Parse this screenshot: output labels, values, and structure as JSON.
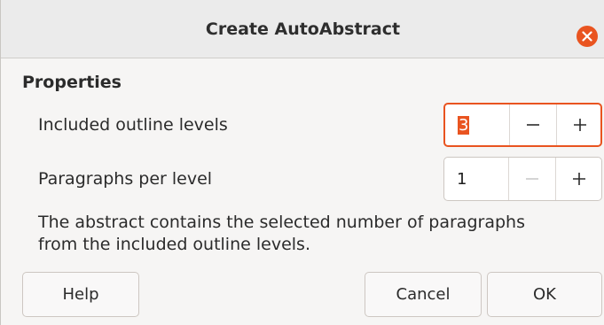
{
  "window": {
    "title": "Create AutoAbstract",
    "close_icon": "close-icon",
    "accent": "#e95420"
  },
  "properties": {
    "heading": "Properties",
    "outline_levels": {
      "label": "Included outline levels",
      "value": "3"
    },
    "paragraphs": {
      "label": "Paragraphs per level",
      "value": "1"
    },
    "description_line1": "The abstract contains the selected number of paragraphs",
    "description_line2": "from the included outline levels."
  },
  "buttons": {
    "help": "Help",
    "cancel": "Cancel",
    "ok": "OK"
  }
}
